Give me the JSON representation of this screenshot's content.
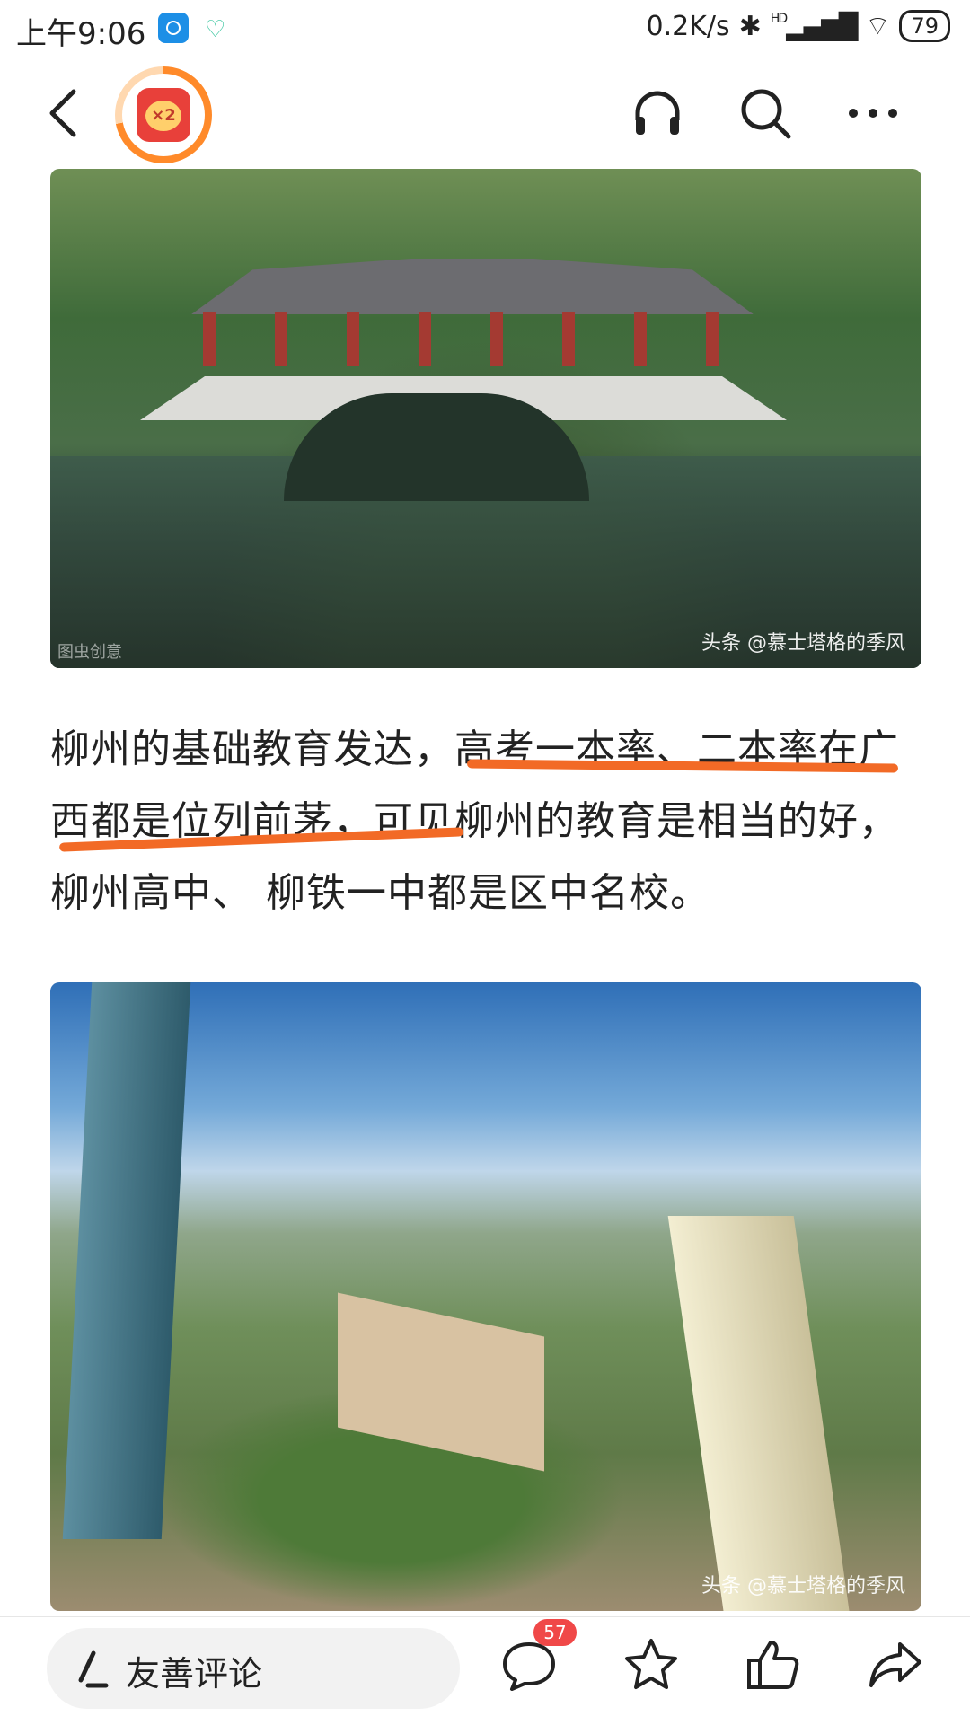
{
  "status_bar": {
    "time": "上午9:06",
    "net_speed": "0.2K/s",
    "signal": "HD",
    "battery": "79"
  },
  "top_nav": {
    "badge_text": "×2"
  },
  "images": [
    {
      "watermark": "头条 @慕士塔格的季风",
      "corner_mark": "图虫创意"
    },
    {
      "watermark": "头条 @慕士塔格的季风"
    }
  ],
  "article": {
    "paragraph": "柳州的基础教育发达，高考一本率、二本率在广西都是位列前茅，可见柳州的教育是相当的好，柳州高中、 柳铁一中都是区中名校。"
  },
  "bottom_bar": {
    "comment_placeholder": "友善评论",
    "comment_count": "57"
  },
  "colors": {
    "highlight": "#f26a26",
    "badge": "#f04848",
    "accent_orange": "#ff8a2a"
  }
}
